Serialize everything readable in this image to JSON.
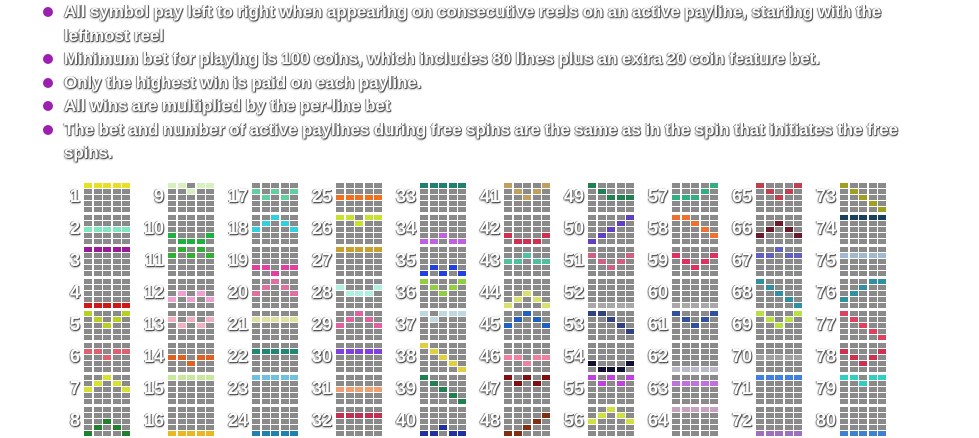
{
  "rules": [
    "All symbol pay left to right when appearing on consecutive reels on an active payline, starting with the leftmost reel",
    "Minimum bet for playing is 100 coins, which includes 80 lines plus an extra 20 coin feature bet.",
    "Only the highest win is paid on each payline.",
    "All wins are multiplied by the per-line bet",
    "The bet and number of active paylines during free spins are the same as in the spin that initiates the free spins."
  ],
  "paylines": [
    {
      "n": "1",
      "color": "#e8e020",
      "rows": [
        0,
        0,
        0,
        0,
        0
      ]
    },
    {
      "n": "2",
      "color": "#7fe8c0",
      "rows": [
        2,
        2,
        2,
        2,
        2
      ]
    },
    {
      "n": "3",
      "color": "#9a1a9a",
      "rows": [
        0,
        0,
        0,
        0,
        0
      ]
    },
    {
      "n": "4",
      "color": "#d01818",
      "rows": [
        4,
        4,
        4,
        4,
        4
      ]
    },
    {
      "n": "5",
      "color": "#b8d020",
      "rows": [
        0,
        1,
        2,
        1,
        0
      ]
    },
    {
      "n": "6",
      "color": "#e06070",
      "rows": [
        1,
        1,
        2,
        1,
        1
      ]
    },
    {
      "n": "7",
      "color": "#d8e030",
      "rows": [
        2,
        1,
        0,
        1,
        2
      ]
    },
    {
      "n": "8",
      "color": "#208030",
      "rows": [
        4,
        3,
        2,
        3,
        4
      ]
    },
    {
      "n": "9",
      "color": "#d8f0c0",
      "rows": [
        0,
        0,
        1,
        0,
        0
      ]
    },
    {
      "n": "10",
      "color": "#20b040",
      "rows": [
        3,
        4,
        4,
        4,
        3
      ]
    },
    {
      "n": "11",
      "color": "#30b030",
      "rows": [
        1,
        0,
        1,
        0,
        1
      ]
    },
    {
      "n": "12",
      "color": "#f0a0d0",
      "rows": [
        3,
        2,
        3,
        2,
        3
      ]
    },
    {
      "n": "13",
      "color": "#f0b0c0",
      "rows": [
        1,
        2,
        1,
        2,
        1
      ]
    },
    {
      "n": "14",
      "color": "#e06020",
      "rows": [
        2,
        2,
        3,
        2,
        2
      ]
    },
    {
      "n": "15",
      "color": "#c8e8a0",
      "rows": [
        0,
        0,
        0,
        0,
        0
      ]
    },
    {
      "n": "16",
      "color": "#e8b820",
      "rows": [
        4,
        4,
        4,
        4,
        4
      ]
    },
    {
      "n": "17",
      "color": "#60d0a0",
      "rows": [
        1,
        2,
        1,
        2,
        1
      ]
    },
    {
      "n": "18",
      "color": "#30d0e0",
      "rows": [
        2,
        1,
        0,
        1,
        2
      ]
    },
    {
      "n": "19",
      "color": "#e040a0",
      "rows": [
        3,
        3,
        4,
        3,
        3
      ]
    },
    {
      "n": "20",
      "color": "#e070a0",
      "rows": [
        2,
        1,
        0,
        1,
        2
      ]
    },
    {
      "n": "21",
      "color": "#e0e0a0",
      "rows": [
        1,
        1,
        1,
        1,
        1
      ]
    },
    {
      "n": "22",
      "color": "#208870",
      "rows": [
        1,
        1,
        1,
        1,
        1
      ]
    },
    {
      "n": "23",
      "color": "#70c0e0",
      "rows": [
        0,
        0,
        0,
        0,
        0
      ]
    },
    {
      "n": "24",
      "color": "#2080b0",
      "rows": [
        4,
        4,
        4,
        4,
        4
      ]
    },
    {
      "n": "25",
      "color": "#f07020",
      "rows": [
        2,
        2,
        2,
        2,
        2
      ]
    },
    {
      "n": "26",
      "color": "#c8e030",
      "rows": [
        0,
        0,
        1,
        0,
        0
      ]
    },
    {
      "n": "27",
      "color": "#c8a030",
      "rows": [
        0,
        0,
        0,
        0,
        0
      ]
    },
    {
      "n": "28",
      "color": "#b0f0e0",
      "rows": [
        1,
        2,
        2,
        2,
        1
      ]
    },
    {
      "n": "29",
      "color": "#e060a0",
      "rows": [
        2,
        1,
        0,
        1,
        2
      ]
    },
    {
      "n": "30",
      "color": "#8040e0",
      "rows": [
        1,
        1,
        1,
        1,
        1
      ]
    },
    {
      "n": "31",
      "color": "#f0a070",
      "rows": [
        2,
        2,
        2,
        2,
        2
      ]
    },
    {
      "n": "32",
      "color": "#c03050",
      "rows": [
        1,
        1,
        1,
        1,
        1
      ]
    },
    {
      "n": "33",
      "color": "#208070",
      "rows": [
        0,
        0,
        0,
        0,
        0
      ]
    },
    {
      "n": "34",
      "color": "#c060e0",
      "rows": [
        4,
        4,
        3,
        4,
        4
      ]
    },
    {
      "n": "35",
      "color": "#2040e0",
      "rows": [
        4,
        3,
        4,
        3,
        4
      ]
    },
    {
      "n": "36",
      "color": "#90d040",
      "rows": [
        0,
        1,
        2,
        1,
        0
      ]
    },
    {
      "n": "37",
      "color": "#c0d8e0",
      "rows": [
        0,
        1,
        0,
        0,
        0
      ]
    },
    {
      "n": "38",
      "color": "#e0d040",
      "rows": [
        0,
        1,
        2,
        3,
        4
      ]
    },
    {
      "n": "39",
      "color": "#208050",
      "rows": [
        0,
        1,
        2,
        3,
        4
      ]
    },
    {
      "n": "40",
      "color": "#2030a0",
      "rows": [
        4,
        4,
        3,
        4,
        4
      ]
    },
    {
      "n": "41",
      "color": "#c0a060",
      "rows": [
        0,
        1,
        2,
        1,
        0
      ]
    },
    {
      "n": "42",
      "color": "#d03050",
      "rows": [
        3,
        4,
        4,
        4,
        3
      ]
    },
    {
      "n": "43",
      "color": "#50c0a0",
      "rows": [
        2,
        2,
        1,
        2,
        2
      ]
    },
    {
      "n": "44",
      "color": "#d8e070",
      "rows": [
        4,
        3,
        2,
        3,
        4
      ]
    },
    {
      "n": "45",
      "color": "#2060c0",
      "rows": [
        2,
        1,
        0,
        1,
        2
      ]
    },
    {
      "n": "46",
      "color": "#f080a0",
      "rows": [
        2,
        2,
        3,
        2,
        2
      ]
    },
    {
      "n": "47",
      "color": "#801010",
      "rows": [
        0,
        1,
        0,
        1,
        0
      ]
    },
    {
      "n": "48",
      "color": "#803010",
      "rows": [
        4,
        4,
        3,
        2,
        1
      ]
    },
    {
      "n": "49",
      "color": "#208050",
      "rows": [
        0,
        1,
        2,
        2,
        2
      ]
    },
    {
      "n": "50",
      "color": "#6040c0",
      "rows": [
        4,
        3,
        2,
        1,
        0
      ]
    },
    {
      "n": "51",
      "color": "#d06080",
      "rows": [
        1,
        2,
        3,
        2,
        1
      ]
    },
    {
      "n": "52",
      "color": "#a8a8a8",
      "rows": [
        4,
        4,
        4,
        4,
        4
      ]
    },
    {
      "n": "53",
      "color": "#304080",
      "rows": [
        0,
        0,
        1,
        2,
        3
      ]
    },
    {
      "n": "54",
      "color": "#101030",
      "rows": [
        3,
        4,
        4,
        4,
        3
      ]
    },
    {
      "n": "55",
      "color": "#c040e0",
      "rows": [
        0,
        1,
        0,
        1,
        0
      ]
    },
    {
      "n": "56",
      "color": "#d0e040",
      "rows": [
        2,
        1,
        0,
        1,
        2
      ]
    },
    {
      "n": "57",
      "color": "#30b080",
      "rows": [
        2,
        2,
        2,
        1,
        0
      ]
    },
    {
      "n": "58",
      "color": "#f07030",
      "rows": [
        0,
        0,
        1,
        2,
        3
      ]
    },
    {
      "n": "59",
      "color": "#e03060",
      "rows": [
        1,
        2,
        3,
        2,
        1
      ]
    },
    {
      "n": "60",
      "color": "#a8a8a8",
      "rows": [
        4,
        4,
        4,
        4,
        4
      ]
    },
    {
      "n": "61",
      "color": "#3050a0",
      "rows": [
        0,
        1,
        2,
        1,
        0
      ]
    },
    {
      "n": "62",
      "color": "#b8b8c8",
      "rows": [
        4,
        4,
        4,
        4,
        4
      ]
    },
    {
      "n": "63",
      "color": "#c070e0",
      "rows": [
        1,
        1,
        1,
        1,
        1
      ]
    },
    {
      "n": "64",
      "color": "#c8a0c0",
      "rows": [
        0,
        0,
        0,
        0,
        0
      ]
    },
    {
      "n": "65",
      "color": "#c04050",
      "rows": [
        0,
        1,
        2,
        1,
        0
      ]
    },
    {
      "n": "66",
      "color": "#6a1a2a",
      "rows": [
        3,
        2,
        1,
        2,
        3
      ]
    },
    {
      "n": "67",
      "color": "#6060c0",
      "rows": [
        1,
        1,
        0,
        1,
        1
      ]
    },
    {
      "n": "68",
      "color": "#3090a0",
      "rows": [
        0,
        1,
        2,
        3,
        4
      ]
    },
    {
      "n": "69",
      "color": "#b8e040",
      "rows": [
        0,
        1,
        2,
        1,
        0
      ]
    },
    {
      "n": "70",
      "color": "#a0a0a0",
      "rows": [
        2,
        2,
        2,
        2,
        2
      ]
    },
    {
      "n": "71",
      "color": "#4080e0",
      "rows": [
        0,
        0,
        0,
        0,
        0
      ]
    },
    {
      "n": "72",
      "color": "#a070c0",
      "rows": [
        4,
        4,
        4,
        4,
        4
      ]
    },
    {
      "n": "73",
      "color": "#a0a020",
      "rows": [
        0,
        1,
        2,
        3,
        4
      ]
    },
    {
      "n": "74",
      "color": "#1a4060",
      "rows": [
        0,
        0,
        0,
        0,
        0
      ]
    },
    {
      "n": "75",
      "color": "#a0b8d0",
      "rows": [
        1,
        1,
        1,
        1,
        1
      ]
    },
    {
      "n": "76",
      "color": "#3090a0",
      "rows": [
        3,
        2,
        1,
        0,
        0
      ]
    },
    {
      "n": "77",
      "color": "#e04060",
      "rows": [
        0,
        1,
        2,
        3,
        4
      ]
    },
    {
      "n": "78",
      "color": "#d03050",
      "rows": [
        1,
        2,
        3,
        2,
        1
      ]
    },
    {
      "n": "79",
      "color": "#30d0c0",
      "rows": [
        0,
        0,
        1,
        0,
        0
      ]
    },
    {
      "n": "80",
      "color": "#4080d0",
      "rows": [
        4,
        4,
        4,
        4,
        4
      ]
    }
  ]
}
